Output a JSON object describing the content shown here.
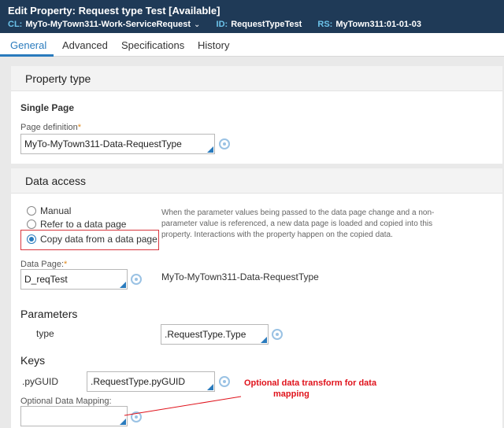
{
  "header": {
    "title": "Edit  Property: Request type Test [Available]",
    "cl_label": "CL:",
    "cl_value": "MyTo-MyTown311-Work-ServiceRequest",
    "id_label": "ID:",
    "id_value": "RequestTypeTest",
    "rs_label": "RS:",
    "rs_value": "MyTown311:01-01-03"
  },
  "tabs": [
    "General",
    "Advanced",
    "Specifications",
    "History"
  ],
  "property_type": {
    "heading": "Property type",
    "mode": "Single Page",
    "page_def_label": "Page definition",
    "page_def_value": "MyTo-MyTown311-Data-RequestType"
  },
  "data_access": {
    "heading": "Data access",
    "options": [
      "Manual",
      "Refer to a data page",
      "Copy data from a data page"
    ],
    "selected": "Copy data from a data page",
    "note": "When the parameter values being passed to the data page change and a non-parameter value is referenced, a new data page is loaded and copied into this property. Interactions with the property happen on the copied data.",
    "data_page_label": "Data Page:",
    "data_page_value": "D_reqTest",
    "data_page_class": "MyTo-MyTown311-Data-RequestType",
    "parameters_heading": "Parameters",
    "param_name": "type",
    "param_value": ".RequestType.Type",
    "keys_heading": "Keys",
    "key_name": ".pyGUID",
    "key_value": ".RequestType.pyGUID",
    "optional_mapping_label": "Optional Data Mapping:",
    "optional_mapping_value": ""
  },
  "annotation": {
    "line1": "Optional data transform for data",
    "line2": "mapping",
    "color": "#e0121b"
  },
  "colors": {
    "header_bg": "#1f3a57",
    "accent": "#2a7bbd",
    "required": "#e08a1e"
  }
}
